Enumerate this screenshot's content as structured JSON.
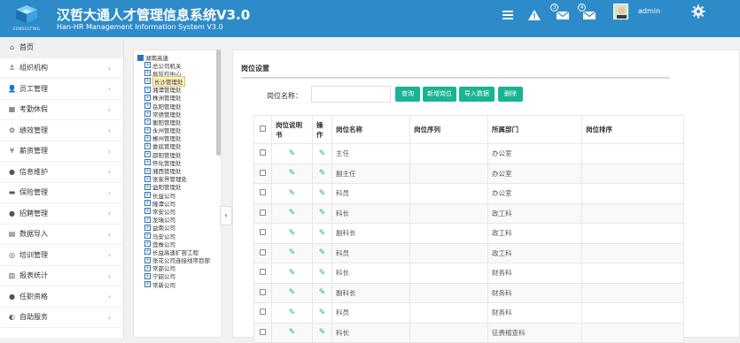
{
  "header": {
    "title": "汉哲大通人才管理信息系统V3.0",
    "subtitle": "Han-HR Management Information System V3.0",
    "logo_text": "CONSULTING",
    "badge_messages": "3",
    "badge_notifications": "4",
    "username": "admin",
    "icons": [
      "menu-icon",
      "alert-icon",
      "mail-icon",
      "message-icon",
      "avatar",
      "gear-icon"
    ]
  },
  "sidebar": {
    "items": [
      {
        "label": "首页",
        "icon": "⌂",
        "active": true
      },
      {
        "label": "组织机构",
        "icon": "⚓"
      },
      {
        "label": "员工管理",
        "icon": "👤"
      },
      {
        "label": "考勤休假",
        "icon": "▦"
      },
      {
        "label": "绩效管理",
        "icon": "⚙"
      },
      {
        "label": "薪资管理",
        "icon": "¥"
      },
      {
        "label": "信息维护",
        "icon": "●"
      },
      {
        "label": "保险管理",
        "icon": "▬"
      },
      {
        "label": "招聘管理",
        "icon": "●"
      },
      {
        "label": "数据导入",
        "icon": "▤"
      },
      {
        "label": "培训管理",
        "icon": "◎"
      },
      {
        "label": "报表统计",
        "icon": "▥"
      },
      {
        "label": "任职资格",
        "icon": "●"
      },
      {
        "label": "自助服务",
        "icon": "◐"
      }
    ]
  },
  "tree": {
    "root": "湖南高速",
    "nodes": [
      "总公司机关",
      "局监控中心",
      "长沙管理处",
      "湘潭管理处",
      "株洲管理处",
      "岳阳管理处",
      "常德管理处",
      "衡阳管理处",
      "永州管理处",
      "郴州管理处",
      "娄底管理处",
      "邵阳管理处",
      "怀化管理处",
      "湘西管理处",
      "张家界管理处",
      "益阳管理处",
      "长益公司",
      "隆潭公司",
      "常安公司",
      "龙瑞公司",
      "益南公司",
      "马安公司",
      "莲株公司",
      "长益高速扩容工程",
      "张花公司连接线项目部",
      "常邵公司",
      "宁韶公司",
      "常新公司"
    ],
    "selected": "长沙管理处"
  },
  "main": {
    "title": "岗位设置",
    "search_label": "岗位名称：",
    "search_value": "",
    "buttons": [
      "查询",
      "新增岗位",
      "导入数据",
      "删除"
    ],
    "columns": [
      "岗位说明书",
      "操作",
      "岗位名称",
      "岗位序列",
      "所属部门",
      "岗位排序"
    ],
    "rows": [
      {
        "name": "主任",
        "seq": "",
        "dept": "办公室",
        "order": ""
      },
      {
        "name": "副主任",
        "seq": "",
        "dept": "办公室",
        "order": ""
      },
      {
        "name": "科员",
        "seq": "",
        "dept": "办公室",
        "order": ""
      },
      {
        "name": "科长",
        "seq": "",
        "dept": "政工科",
        "order": ""
      },
      {
        "name": "副科长",
        "seq": "",
        "dept": "政工科",
        "order": ""
      },
      {
        "name": "科员",
        "seq": "",
        "dept": "政工科",
        "order": ""
      },
      {
        "name": "科长",
        "seq": "",
        "dept": "财务科",
        "order": ""
      },
      {
        "name": "副科长",
        "seq": "",
        "dept": "财务科",
        "order": ""
      },
      {
        "name": "科员",
        "seq": "",
        "dept": "财务科",
        "order": ""
      },
      {
        "name": "科长",
        "seq": "",
        "dept": "征费稽查科",
        "order": ""
      }
    ]
  },
  "colors": {
    "header": "#2e8bc9",
    "accent_green": "#1ab394",
    "tree_blue": "#2e74b5"
  }
}
